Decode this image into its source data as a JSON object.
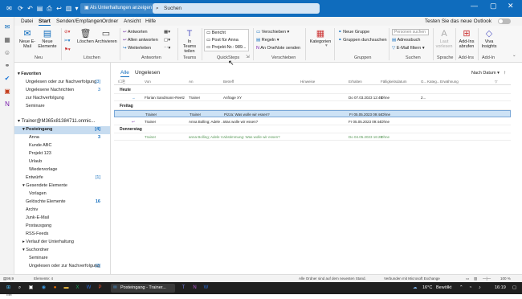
{
  "titlebar": {
    "tab_label": "Als Unterhaltungen anzeigen",
    "search_placeholder": "Suchen"
  },
  "menu": {
    "tabs": [
      "Datei",
      "Start",
      "Senden/Empfangen",
      "Ordner",
      "Ansicht",
      "Hilfe"
    ],
    "active": "Start",
    "try_new": "Testen Sie das neue Outlook"
  },
  "ribbon": {
    "groups": [
      "Neu",
      "Löschen",
      "Antworten",
      "Teams",
      "QuickSteps",
      "Verschieben",
      "Kategorien",
      "Gruppen",
      "Suchen",
      "Sprache",
      "Add-Ins",
      "Add-In"
    ],
    "neu": {
      "new_email": "Neue E-Mail",
      "new_items": "Neue Elemente"
    },
    "delete": {
      "delete": "Löschen",
      "archive": "Archivieren"
    },
    "respond": {
      "reply": "Antworten",
      "reply_all": "Allen antworten",
      "forward": "Weiterleiten"
    },
    "teams": {
      "share": "In Teams teilen"
    },
    "quicksteps": [
      "Bericht",
      "Post für Anna",
      "Projekt-Nr.: 989..."
    ],
    "move": {
      "move": "Verschieben",
      "rules": "Regeln",
      "onenote": "An OneNote senden"
    },
    "tags": {
      "categorize": "Kategorien"
    },
    "groups_btns": {
      "new_group": "Neue Gruppe",
      "browse": "Gruppen durchsuchen"
    },
    "find": {
      "search_people": "Personen suchen",
      "address_book": "Adressbuch",
      "filter": "E-Mail filtern"
    },
    "speech": {
      "read_aloud": "Laut vorlesen"
    },
    "addins": {
      "get": "Add-Ins abrufen"
    },
    "viva": {
      "insights": "Viva Insights"
    }
  },
  "folders": {
    "favorites": "Favoriten",
    "fav_items": [
      {
        "label": "Ungelesen oder zur Nachverfolgung",
        "count": "[3]"
      },
      {
        "label": "Ungelesene Nachrichten",
        "count": "3"
      },
      {
        "label": "zur Nachverfolgung",
        "count": ""
      },
      {
        "label": "Seminare",
        "count": ""
      }
    ],
    "account": "Trainer@M365x81384711.onmic...",
    "account_items": [
      {
        "label": "Posteingang",
        "count": "[4]",
        "sel": true,
        "indent": 1
      },
      {
        "label": "Anna",
        "count": "3",
        "indent": 2
      },
      {
        "label": "Kunde ABC",
        "count": "",
        "indent": 2
      },
      {
        "label": "Projekt 123",
        "count": "",
        "indent": 2
      },
      {
        "label": "Urlaub",
        "count": "",
        "indent": 2
      },
      {
        "label": "Wiedervorlage",
        "count": "",
        "indent": 2
      },
      {
        "label": "Entwürfe",
        "count": "[1]",
        "indent": 1
      },
      {
        "label": "Gesendete Elemente",
        "count": "",
        "indent": 1
      },
      {
        "label": "Vorlagen",
        "count": "",
        "indent": 2
      },
      {
        "label": "Gelöschte Elemente",
        "count": "16",
        "indent": 1
      },
      {
        "label": "Archiv",
        "count": "",
        "indent": 1
      },
      {
        "label": "Junk-E-Mail",
        "count": "",
        "indent": 1
      },
      {
        "label": "Postausgang",
        "count": "",
        "indent": 1
      },
      {
        "label": "RSS-Feeds",
        "count": "",
        "indent": 1
      },
      {
        "label": "Verlauf der Unterhaltung",
        "count": "",
        "indent": 1
      },
      {
        "label": "Suchordner",
        "count": "",
        "indent": 1
      },
      {
        "label": "Seminare",
        "count": "",
        "indent": 2
      },
      {
        "label": "Ungelesen oder zur Nachverfolgung",
        "count": "[3]",
        "indent": 2
      }
    ]
  },
  "list": {
    "tab_all": "Alle",
    "tab_unread": "Ungelesen",
    "sort": "Nach Datum",
    "columns": [
      "Von",
      "An",
      "Betreff",
      "Hinweise",
      "Erhalten",
      "Fälligkeitsdatum",
      "G...",
      "Kateg...",
      "Erwähnung"
    ],
    "groups": [
      "Heute",
      "Freitag",
      "Donnerstag"
    ],
    "rows": [
      {
        "from": "Florian Sandmann-Reetz",
        "to": "Trainer",
        "subject": "Anfrage XY",
        "received": "Do 07.03.2023 12:49",
        "due": "Ohne",
        "size": "2...",
        "group": 0
      },
      {
        "from": "Trainer",
        "to": "Trainer",
        "subject": "Pizza: Was wolle wir essen?",
        "received": "Fr 05.05.2023 09:44",
        "due": "Ohne",
        "size": "",
        "group": 1,
        "sel": true
      },
      {
        "from": "Trainer",
        "to": "Anna Bolling; Adele ...",
        "subject": "Was wolle wir essen?",
        "received": "Fr 05.05.2023 09:44",
        "due": "Ohne",
        "size": "",
        "group": 1
      },
      {
        "from": "Trainer",
        "to": "anna Bolling; Adele V...",
        "subject": "Abstimmung: Was wolle wir essen?",
        "received": "Do 04.05.2023 16:28",
        "due": "Ohne",
        "size": "",
        "group": 2,
        "dim": true
      }
    ]
  },
  "status": {
    "items": "Elemente: 4",
    "size": "99,9 GB frei",
    "sync": "Alle Ordner sind auf dem neuesten Stand.",
    "conn": "Verbunden mit Microsoft Exchange",
    "zoom": "100 %"
  },
  "taskbar": {
    "active_label": "Posteingang - Trainer...",
    "weather": "16°C",
    "weather_desc": "Bewölkt",
    "time": "16:19"
  }
}
